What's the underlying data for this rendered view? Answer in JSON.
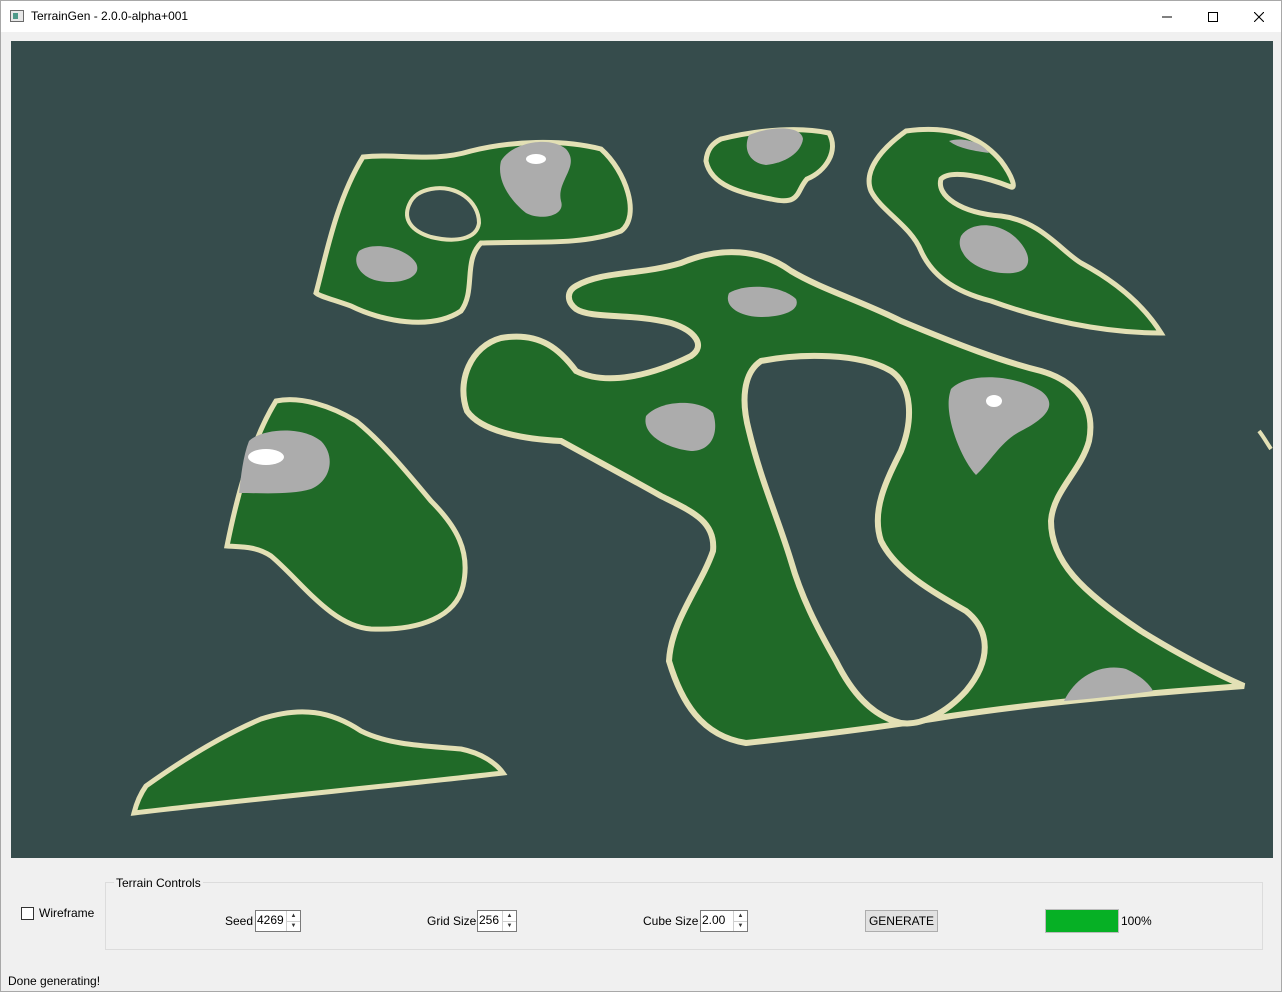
{
  "window": {
    "title": "TerrainGen - 2.0.0-alpha+001",
    "icons": [
      "app-icon",
      "minimize-icon",
      "maximize-icon",
      "close-icon"
    ]
  },
  "viewport": {
    "colors": {
      "background": "#364c4c",
      "grass": "#206a28",
      "sand": "#e3e0b5",
      "rock": "#acacac",
      "snow": "#ffffff"
    }
  },
  "controls": {
    "wireframe_label": "Wireframe",
    "wireframe_checked": false,
    "group_title": "Terrain Controls",
    "seed_label": "Seed",
    "seed_value": "4269",
    "grid_label": "Grid Size",
    "grid_value": "256",
    "cube_label": "Cube Size",
    "cube_value": "2.00",
    "generate_label": "GENERATE",
    "progress_percent": 100,
    "progress_text": "100%",
    "progress_color": "#06b025"
  },
  "status": {
    "message": "Done generating!"
  }
}
